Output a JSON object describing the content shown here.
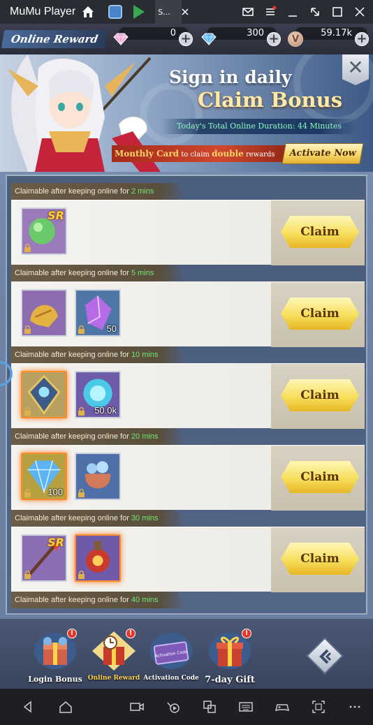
{
  "window": {
    "title": "MuMu Player",
    "active_tab_label": "S..."
  },
  "hud": {
    "title": "Online Reward",
    "pink_gems": "0",
    "blue_gems": "300",
    "coins": "59.17k",
    "coin_symbol": "V",
    "plus": "+"
  },
  "banner": {
    "line1": "Sign in daily",
    "line2": "Claim Bonus",
    "duration": "Today's Total Online Duration: 44 Minutes",
    "monthly_card": "Monthly Card",
    "monthly_text_1": " to claim ",
    "monthly_double": "double",
    "monthly_text_2": " rewards",
    "activate_label": "Activate Now",
    "close_symbol": "✕"
  },
  "rewards": [
    {
      "label": "Claimable after keeping online for ",
      "mins": "2 mins",
      "claim": "Claim",
      "items": [
        {
          "icon": "green-orb-icon",
          "qty": "",
          "sr": "SR"
        }
      ]
    },
    {
      "label": "Claimable after keeping online for ",
      "mins": "5 mins",
      "claim": "Claim",
      "items": [
        {
          "icon": "golden-helmet-icon",
          "qty": "",
          "sr": ""
        },
        {
          "icon": "purple-crystal-icon",
          "qty": "50",
          "sr": ""
        }
      ]
    },
    {
      "label": "Claimable after keeping online for ",
      "mins": "10 mins",
      "claim": "Claim",
      "items": [
        {
          "icon": "rune-tablet-icon",
          "qty": "",
          "sr": ""
        },
        {
          "icon": "blue-energy-orb-icon",
          "qty": "50.0k",
          "sr": ""
        }
      ]
    },
    {
      "label": "Claimable after keeping online for ",
      "mins": "20 mins",
      "claim": "Claim",
      "items": [
        {
          "icon": "blue-diamond-icon",
          "qty": "100",
          "sr": ""
        },
        {
          "icon": "gem-bag-icon",
          "qty": "",
          "sr": ""
        }
      ]
    },
    {
      "label": "Claimable after keeping online for ",
      "mins": "30 mins",
      "claim": "Claim",
      "items": [
        {
          "icon": "staff-weapon-icon",
          "qty": "",
          "sr": "SR"
        },
        {
          "icon": "red-lantern-icon",
          "qty": "",
          "sr": ""
        }
      ]
    },
    {
      "label": "Claimable after keeping online for ",
      "mins": "40 mins",
      "claim": "",
      "items": []
    }
  ],
  "nav": [
    {
      "label": "Login Bonus",
      "badge": "!"
    },
    {
      "label": "Online Reward",
      "badge": "!"
    },
    {
      "label": "Activation Code",
      "badge": "",
      "card_text": "Activation Code"
    },
    {
      "label": "7-day Gift",
      "badge": "!"
    }
  ],
  "colors": {
    "claim_gold": "#f7df5c",
    "mins_green": "#6fe86f",
    "badge_red": "#e8352b"
  }
}
